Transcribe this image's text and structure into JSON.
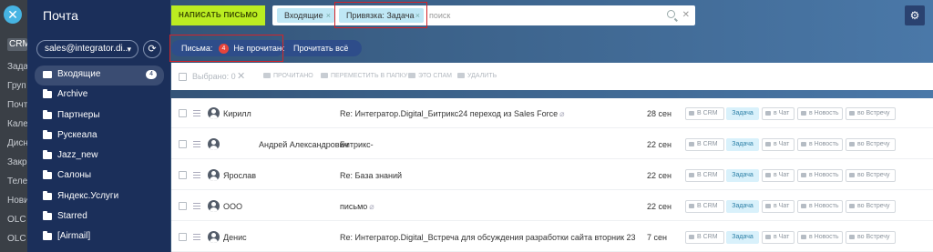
{
  "crm_strip": {
    "close_glyph": "✕",
    "items": [
      "CRM",
      "Зада",
      "Груп",
      "Почт",
      "Кале",
      "Дисн",
      "Закр",
      "Теле",
      "Нови",
      "OLC",
      "OLC"
    ]
  },
  "sidebar": {
    "title": "Почта",
    "mailbox": "sales@integrator.di...",
    "caret": "▾",
    "refresh_glyph": "⟳",
    "folders": [
      {
        "label": "Входящие",
        "count": "4"
      },
      {
        "label": "Archive"
      },
      {
        "label": "Партнеры"
      },
      {
        "label": "Рускеала"
      },
      {
        "label": "Jazz_new"
      },
      {
        "label": "Салоны"
      },
      {
        "label": "Яндекс.Услуги"
      },
      {
        "label": "Starred"
      },
      {
        "label": "[Airmail]"
      }
    ]
  },
  "header": {
    "write_button": "НАПИСАТЬ ПИСЬМО",
    "chips": [
      {
        "label": "Входящие",
        "remove": "×"
      },
      {
        "label": "Привязка: Задача",
        "remove": "×"
      }
    ],
    "search_placeholder": "поиск",
    "search_clear": "✕",
    "settings_glyph": "⚙"
  },
  "filters": {
    "letters_label": "Письма:",
    "unread_count": "4",
    "unread_label": "Не прочитано",
    "read_all": "Прочитать всё"
  },
  "toolbar": {
    "selected": "Выбрано: 0",
    "clear": "✕",
    "read": "ПРОЧИТАНО",
    "move": "ПЕРЕМЕСТИТЬ В ПАПКУ",
    "spam": "ЭТО СПАМ",
    "delete": "УДАЛИТЬ"
  },
  "actions": {
    "crm": "В CRM",
    "task": "Задача",
    "chat": "в Чат",
    "news": "в Новость",
    "meeting": "во Встречу"
  },
  "messages": [
    {
      "sender": "Кирилл",
      "subject": "Re: Интегратор.Digital_Битрикс24 переход из Sales Force",
      "attachment": true,
      "date": "28 сен"
    },
    {
      "sender": "Андрей Александрович",
      "subject": "Битрикс-",
      "attachment": false,
      "date": "22 сен"
    },
    {
      "sender": "Ярослав",
      "subject": "Re: База знаний",
      "attachment": false,
      "date": "22 сен"
    },
    {
      "sender": "ООО",
      "subject": "письмо",
      "attachment": true,
      "date": "22 сен"
    },
    {
      "sender": "Денис",
      "subject": "Re: Интегратор.Digital_Встреча для обсуждения разработки сайта вторник 23 август...",
      "attachment": true,
      "date": "7 сен"
    }
  ],
  "colors": {
    "sidebar_bg": "#1b2f5a",
    "write_button": "#bbed21",
    "chip_bg": "#bfe7f5",
    "task_badge": "#d9f1fb",
    "unread_badge": "#e6443b",
    "highlight_box": "#d2232a"
  }
}
